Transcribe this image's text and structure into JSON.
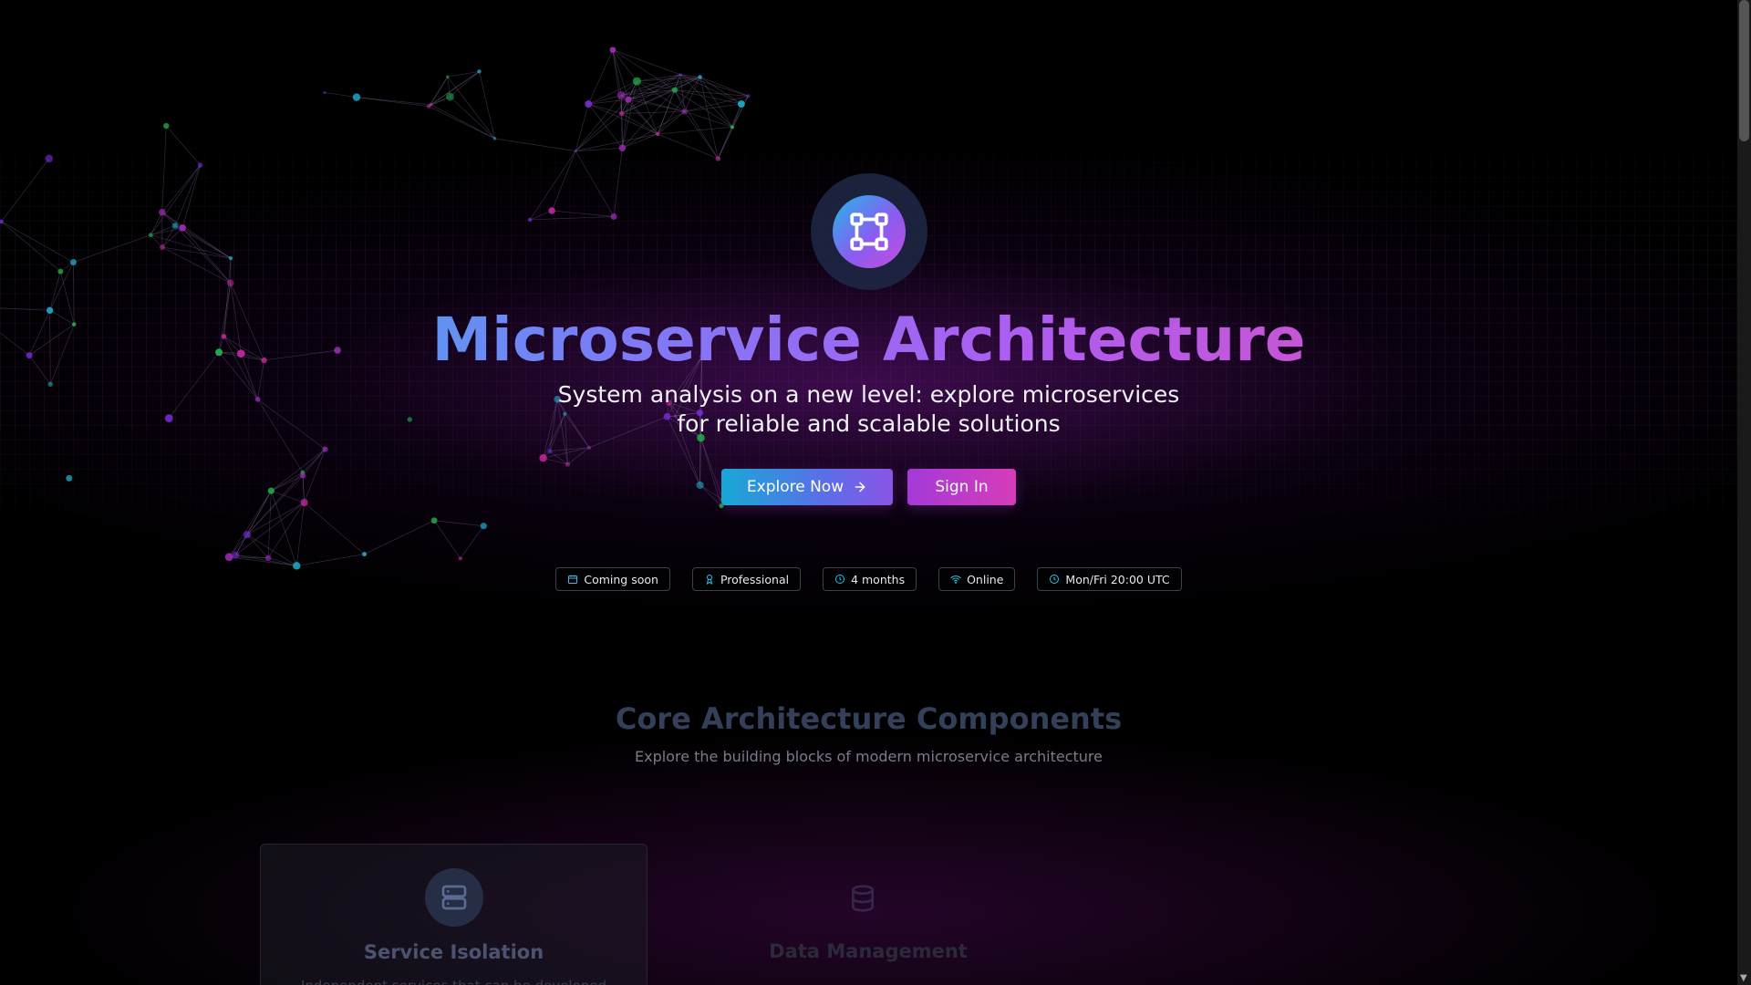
{
  "hero": {
    "title": "Microservice Architecture",
    "subtitle_line1": "System analysis on a new level: explore microservices",
    "subtitle_line2": "for reliable and scalable solutions",
    "icon": "network-nodes-icon"
  },
  "actions": {
    "explore_label": "Explore Now",
    "signin_label": "Sign In"
  },
  "badges": [
    {
      "icon": "calendar-icon",
      "label": "Coming soon"
    },
    {
      "icon": "award-icon",
      "label": "Professional"
    },
    {
      "icon": "clock-icon",
      "label": "4 months"
    },
    {
      "icon": "wifi-icon",
      "label": "Online"
    },
    {
      "icon": "clock-icon",
      "label": "Mon/Fri 20:00 UTC"
    }
  ],
  "components": {
    "title": "Core Architecture Components",
    "subtitle": "Explore the building blocks of modern microservice architecture",
    "cards": [
      {
        "icon": "server-icon",
        "title": "Service Isolation",
        "description": "Independent services that can be developed"
      },
      {
        "icon": "database-icon",
        "title": "Data Management"
      }
    ]
  },
  "colors": {
    "accent_cyan": "#22c8ee",
    "accent_purple": "#b05cf0",
    "accent_pink": "#e84ca8",
    "background": "#000000"
  }
}
